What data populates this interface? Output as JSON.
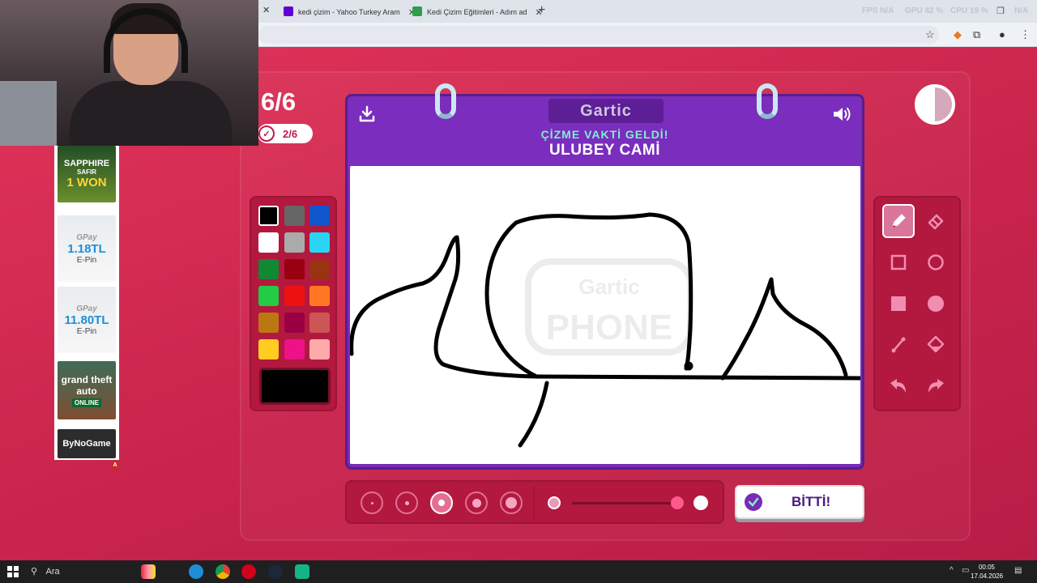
{
  "browser": {
    "tabs": [
      {
        "title": "kedi çizim - Yahoo Turkey Aram",
        "favicon_color": "#6001d2"
      },
      {
        "title": "Kedi Çizim Eğitimleri - Adım ad",
        "favicon_color": "#2e9e48"
      }
    ],
    "overlay": {
      "fps": "FPS N/A",
      "gpu": "GPU 42 %",
      "cpu": "CPU 19 %",
      "ram": "N/A"
    }
  },
  "game": {
    "round": "6/6",
    "done_count": "2/6",
    "logo": "Gartic",
    "instruction": "ÇİZME VAKTİ GELDİ!",
    "word": "ULUBEY CAMİ",
    "watermark_top": "Gartic",
    "watermark_bottom": "PHONE",
    "done_button": "BİTTİ!",
    "palette": [
      "#000000",
      "#666666",
      "#1155cc",
      "#ffffff",
      "#aaaaaa",
      "#2ad4f5",
      "#118833",
      "#990011",
      "#993311",
      "#22cc44",
      "#ee1111",
      "#ff7722",
      "#bb7711",
      "#990044",
      "#cc5555",
      "#ffcc22",
      "#ee1188",
      "#ffaaaa"
    ],
    "selected_color": "#000000",
    "tools": [
      "pencil",
      "eraser",
      "rectangle-outline",
      "ellipse-outline",
      "rectangle-filled",
      "ellipse-filled",
      "line",
      "fill-bucket",
      "undo",
      "redo"
    ],
    "active_tool": "pencil",
    "brush_sizes": [
      1,
      2,
      3,
      4,
      5
    ],
    "selected_brush_size": 3,
    "opacity": 0.9
  },
  "ads": {
    "sapphire": {
      "line1": "SAPPHIRE",
      "line2": "SAFIR",
      "line3": "1 WON"
    },
    "gpay1": {
      "brand": "GPay",
      "amount": "1.18TL",
      "sub": "E-Pin"
    },
    "gpay2": {
      "brand": "GPay",
      "amount": "11.80TL",
      "sub": "E-Pin"
    },
    "gta": {
      "title": "grand theft auto",
      "sub": "ONLINE"
    },
    "bynogame": "ByNoGame",
    "badge": "A"
  },
  "taskbar": {
    "search": "Ara",
    "time": "00:05",
    "date": "17.04.2026"
  }
}
